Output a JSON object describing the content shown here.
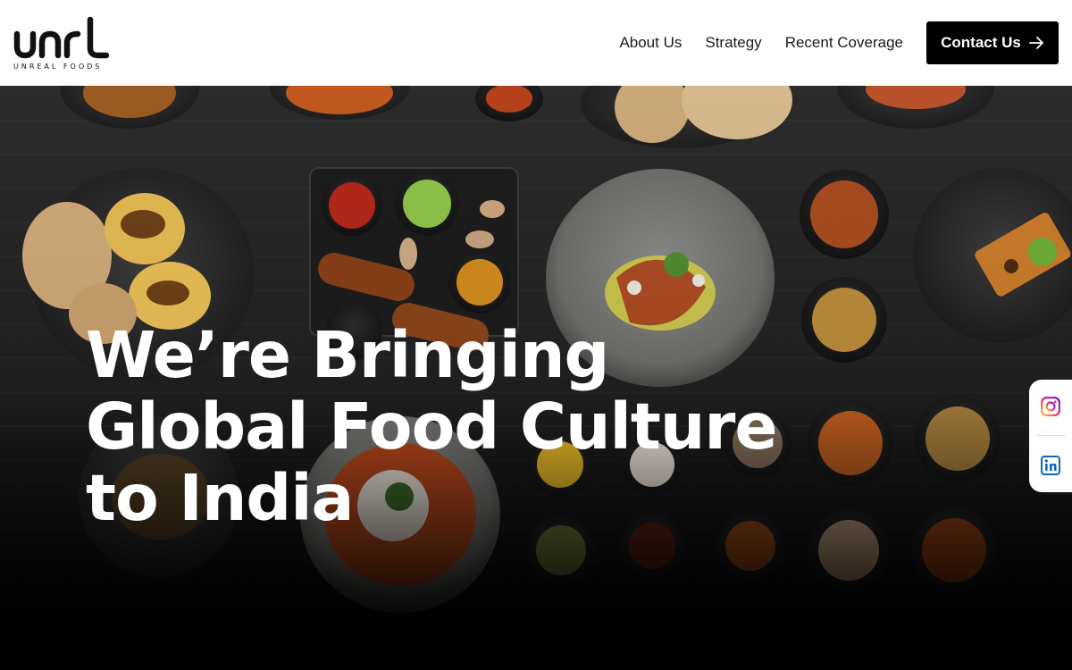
{
  "brand": {
    "logo_text": "unrl",
    "tagline": "UNREAL FOODS"
  },
  "nav": {
    "items": [
      {
        "label": "About Us"
      },
      {
        "label": "Strategy"
      },
      {
        "label": "Recent Coverage"
      }
    ],
    "contact_label": "Contact Us"
  },
  "hero": {
    "headline_lines": [
      "We’re Bringing",
      "Global Food Culture",
      "to India"
    ],
    "image_description_icon": "food-spread-image"
  },
  "social": {
    "items": [
      {
        "icon": "instagram-icon"
      },
      {
        "icon": "linkedin-icon"
      }
    ]
  },
  "colors": {
    "header_bg": "#ffffff",
    "button_bg": "#000000",
    "text_light": "#ffffff",
    "instagram": "#d62976",
    "linkedin": "#0a66c2"
  }
}
